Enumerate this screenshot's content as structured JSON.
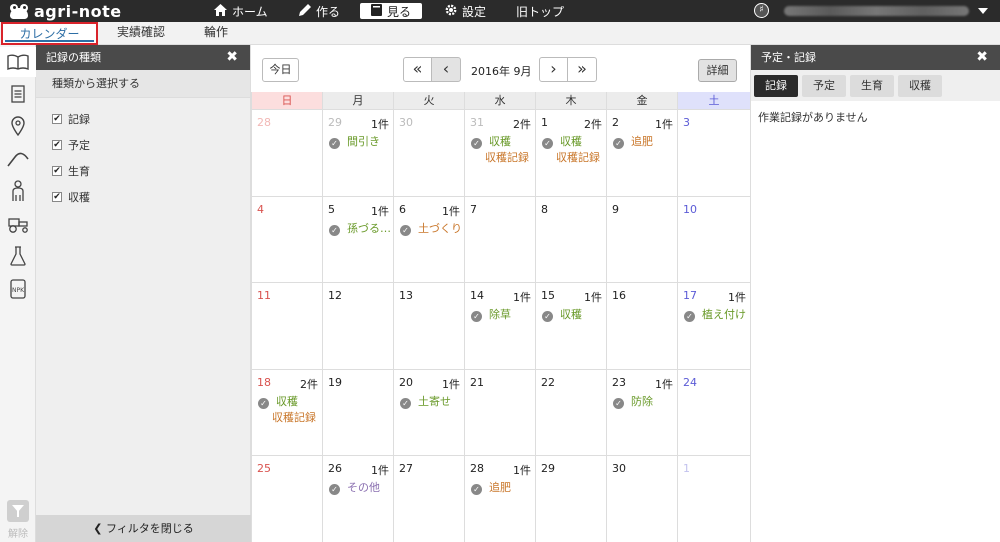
{
  "app": {
    "logo_text": "agri-note"
  },
  "topnav": {
    "home": "ホーム",
    "make": "作る",
    "view": "見る",
    "settings": "設定",
    "old_top": "旧トップ"
  },
  "subtabs": {
    "calendar": "カレンダー",
    "results": "実績確認",
    "rotation": "輪作"
  },
  "rail": {
    "clear_label": "解除"
  },
  "filter": {
    "title": "記録の種類",
    "subtitle": "種類から選択する",
    "items": [
      "記録",
      "予定",
      "生育",
      "収穫"
    ],
    "close_label": "フィルタを閉じる"
  },
  "calendar": {
    "today": "今日",
    "month": "2016年 9月",
    "detail": "詳細",
    "weekdays": [
      "日",
      "月",
      "火",
      "水",
      "木",
      "金",
      "土"
    ],
    "weeks": [
      [
        {
          "d": "28",
          "other": true
        },
        {
          "d": "29",
          "other": true,
          "cnt": "1件",
          "ev": "間引き",
          "color": "green"
        },
        {
          "d": "30",
          "other": true
        },
        {
          "d": "31",
          "other": true,
          "cnt": "2件",
          "ev": "収穫",
          "color": "green",
          "ev2": "収穫記録",
          "color2": "orange"
        },
        {
          "d": "1",
          "cnt": "2件",
          "ev": "収穫",
          "color": "green",
          "ev2": "収穫記録",
          "color2": "orange"
        },
        {
          "d": "2",
          "cnt": "1件",
          "ev": "追肥",
          "color": "orange"
        },
        {
          "d": "3"
        }
      ],
      [
        {
          "d": "4"
        },
        {
          "d": "5",
          "cnt": "1件",
          "ev": "孫づる…",
          "color": "green"
        },
        {
          "d": "6",
          "cnt": "1件",
          "ev": "土づくり",
          "color": "orange"
        },
        {
          "d": "7"
        },
        {
          "d": "8"
        },
        {
          "d": "9"
        },
        {
          "d": "10"
        }
      ],
      [
        {
          "d": "11"
        },
        {
          "d": "12"
        },
        {
          "d": "13"
        },
        {
          "d": "14",
          "cnt": "1件",
          "ev": "除草",
          "color": "green"
        },
        {
          "d": "15",
          "cnt": "1件",
          "ev": "収穫",
          "color": "green"
        },
        {
          "d": "16"
        },
        {
          "d": "17",
          "cnt": "1件",
          "ev": "植え付け",
          "color": "green"
        }
      ],
      [
        {
          "d": "18",
          "cnt": "2件",
          "ev": "収穫",
          "color": "green",
          "ev2": "収穫記録",
          "color2": "orange"
        },
        {
          "d": "19"
        },
        {
          "d": "20",
          "cnt": "1件",
          "ev": "土寄せ",
          "color": "green"
        },
        {
          "d": "21"
        },
        {
          "d": "22"
        },
        {
          "d": "23",
          "cnt": "1件",
          "ev": "防除",
          "color": "green"
        },
        {
          "d": "24"
        }
      ],
      [
        {
          "d": "25"
        },
        {
          "d": "26",
          "cnt": "1件",
          "ev": "その他",
          "color": "purple"
        },
        {
          "d": "27"
        },
        {
          "d": "28",
          "cnt": "1件",
          "ev": "追肥",
          "color": "orange"
        },
        {
          "d": "29"
        },
        {
          "d": "30"
        },
        {
          "d": "1",
          "other": true
        }
      ]
    ]
  },
  "rpanel": {
    "title": "予定・記録",
    "tabs": [
      "記録",
      "予定",
      "生育",
      "収穫"
    ],
    "message": "作業記録がありません"
  },
  "colors": {
    "green": "#6a9a2a",
    "orange": "#c9772b",
    "purple": "#8a6fb0",
    "accent": "#2d6ea5",
    "highlight": "#d9232b"
  }
}
